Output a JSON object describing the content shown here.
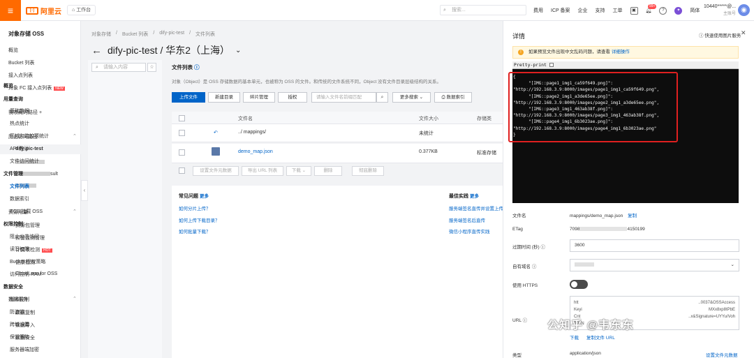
{
  "topbar": {
    "menu_icon": "menu-icon",
    "logo_text": "阿里云",
    "workbench": "工作台",
    "search_placeholder": "搜索...",
    "nav": [
      "费用",
      "ICP 备案",
      "企业",
      "支持",
      "工单"
    ],
    "badge": "99+",
    "lang": "简体",
    "account": "10440*****@...",
    "account_sub": "主账号"
  },
  "sidebar": {
    "title": "对象存储 OSS",
    "items": [
      "概览",
      "Bucket 列表",
      "接入点列表",
      "对象 FC 接入点列表"
    ],
    "new_badge": "NEW",
    "favorites": "我收藏的路径",
    "history": "历史访问路径",
    "history_active": "dify-pic-test",
    "history_blur_suffix": "sult",
    "resources": "资源用量",
    "resource_items": [
      "资源包管理",
      "预警监测管理",
      "计费项检测",
      "健康检测",
      "CloudLens for OSS"
    ],
    "hot_badge": "HOT",
    "data_services": "数据服务",
    "data_items": [
      "数据复制",
      "数据导入",
      "数据安全"
    ]
  },
  "breadcrumb": [
    "对象存储",
    "Bucket 列表",
    "dify-pic-test",
    "文件列表"
  ],
  "page_title": "dify-pic-test / 华东2（上海）",
  "submenu": {
    "filter_placeholder": "请输入内容",
    "overview": "概览",
    "groups": [
      {
        "head": "用量查询",
        "items": [
          "基础数据",
          "热点统计",
          "区域和监控项统计",
          "API 统计",
          "文件访问统计"
        ]
      },
      {
        "head": "文件管理",
        "items": [
          "文件列表",
          "数据索引",
          "ECS 挂载 OSS"
        ]
      },
      {
        "head": "权限控制",
        "items": [
          "阻止公共访问",
          "读写权限",
          "Bucket 授权策略",
          "访问控制 RAM"
        ]
      },
      {
        "head": "数据安全",
        "items": [
          "版本控制",
          "防盗链",
          "跨域设置",
          "保留策略",
          "服务器端加密"
        ]
      }
    ]
  },
  "main": {
    "title": "文件列表",
    "desc": "对象（Object）是 OSS 存储数据的基本单元，也被称为 OSS 的文件。和传统的文件系统不同，Object 没有文件目录层级结构的关系。",
    "buttons": [
      "上传文件",
      "新建目录",
      "碎片管理",
      "授权"
    ],
    "file_search_placeholder": "请输入文件名前缀匹配",
    "more_search": "更多搜索",
    "data_index": "数据索引",
    "columns": [
      "文件名",
      "文件大小",
      "存储类"
    ],
    "rows": [
      {
        "name": "../ mappings/",
        "size": "未统计",
        "class": ""
      },
      {
        "name": "demo_map.json",
        "size": "0.377KB",
        "class": "标准存储"
      }
    ],
    "bulk": [
      "设置文件元数据",
      "导出 URL 列表",
      "下载",
      "删除",
      "彻底删除"
    ],
    "faq_title": "常见问题",
    "more": "更多",
    "faq": [
      "如何分片上传？",
      "如何上传下载目录？",
      "如何批量下载？"
    ],
    "best_title": "最佳实践",
    "best": [
      "服务端签名直传并设置上传回调",
      "服务端签名后直传",
      "微信小程序直传实践"
    ]
  },
  "panel": {
    "title": "详情",
    "help": "快速使用图片服务",
    "alert_text": "如果预览文件出现中文乱码问题，请查看",
    "alert_link": "详细操作",
    "pretty_print": "Pretty-print",
    "code": "{\n      \"[IMG::page1_img1_ca59f649.png]\":\n\"http://192.168.3.9:8000/images/page1_img1_ca59f649.png\",\n      \"[IMG::page2_img1_a3de65ee.png]\":\n\"http://192.168.3.9:8000/images/page2_img1_a3de65ee.png\",\n      \"[IMG::page3_img1_463ab38f.png]\":\n\"http://192.168.3.9:8000/images/page3_img1_463ab38f.png\",\n      \"[IMG::page4_img1_6b3023ae.png]\":\n\"http://192.168.3.9:8000/images/page4_img1_6b3023ae.png\"\n}",
    "filename_label": "文件名",
    "filename": "mappings/demo_map.json",
    "copy": "复制",
    "etag_label": "ETag",
    "etag_prefix": "7098",
    "etag_suffix": "4150199",
    "expire_label": "过期时间 (秒)",
    "expire_value": "3600",
    "domain_label": "自有域名",
    "https_label": "使用 HTTPS",
    "https_on": false,
    "url_label": "URL",
    "url_lines": [
      "htt",
      "Keyi",
      "Cnt",
      "F07N"
    ],
    "url_right": [
      "..0037&OSSAccess",
      "MXx8xp8tPbE",
      "..x&Signature=UYYu/Voh"
    ],
    "download": "下载",
    "open_url": "复制文件 URL",
    "type_label": "类型",
    "type_value": "application/json",
    "meta_link": "设置文件元数据",
    "watermark": "公知乎 @韦东东"
  }
}
